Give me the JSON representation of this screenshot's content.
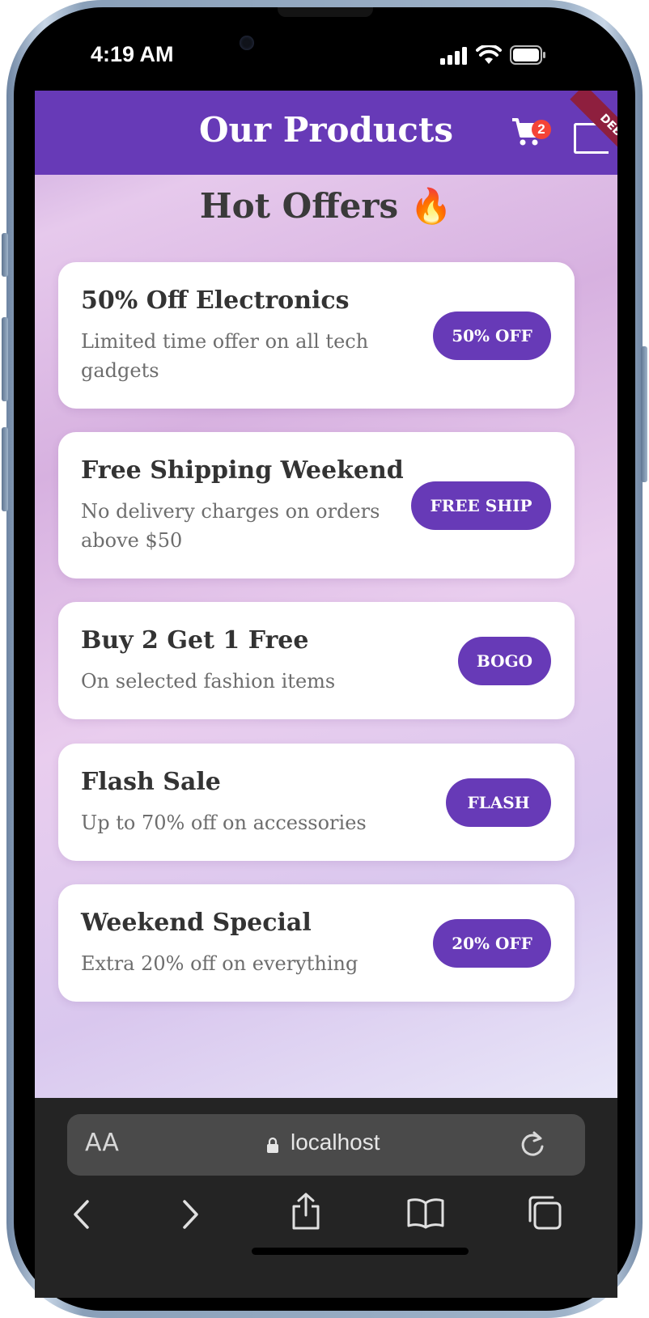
{
  "status_bar": {
    "time": "4:19 AM"
  },
  "app_bar": {
    "title": "Our Products",
    "cart_count": "2",
    "debug_label": "DEBUG"
  },
  "page": {
    "heading": "Hot Offers 🔥"
  },
  "offers": [
    {
      "title": "50% Off Electronics",
      "subtitle": "Limited time offer on all tech gadgets",
      "badge": "50% OFF"
    },
    {
      "title": "Free Shipping Weekend",
      "subtitle": "No delivery charges on orders above $50",
      "badge": "FREE SHIP"
    },
    {
      "title": "Buy 2 Get 1 Free",
      "subtitle": "On selected fashion items",
      "badge": "BOGO"
    },
    {
      "title": "Flash Sale",
      "subtitle": "Up to 70% off on accessories",
      "badge": "FLASH"
    },
    {
      "title": "Weekend Special",
      "subtitle": "Extra 20% off on everything",
      "badge": "20% OFF"
    }
  ],
  "browser": {
    "text_size_label": "AA",
    "url": "localhost"
  },
  "colors": {
    "primary": "#673ab7",
    "badge_red": "#f44336",
    "debug_banner": "#8e1f3e"
  },
  "icons": [
    "cart-icon",
    "bag-icon",
    "lock-icon",
    "reload-icon",
    "back-icon",
    "forward-icon",
    "share-icon",
    "bookmarks-icon",
    "tabs-icon"
  ]
}
